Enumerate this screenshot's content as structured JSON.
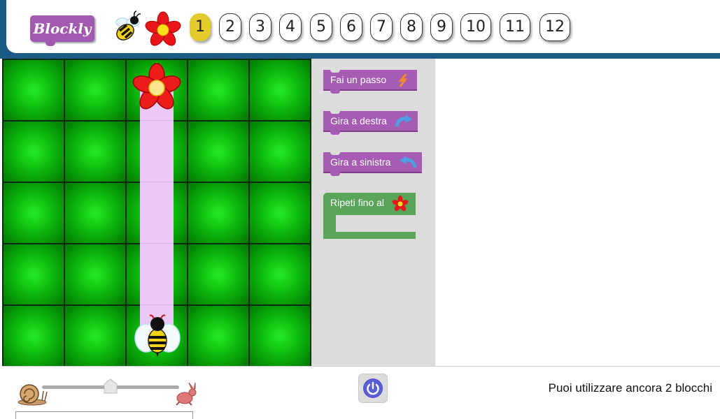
{
  "app": {
    "logo_text": "Blockly"
  },
  "header": {
    "icons": [
      "bee-icon",
      "flower-icon"
    ],
    "levels": [
      "1",
      "2",
      "3",
      "4",
      "5",
      "6",
      "7",
      "8",
      "9",
      "10",
      "11",
      "12"
    ],
    "active_level": "1",
    "colors": {
      "frame": "#1b5a85",
      "active_level": "#e2cc2c"
    }
  },
  "maze": {
    "rows": 5,
    "cols": 5,
    "goal_icon": "flower-icon",
    "player_icon": "bee-icon"
  },
  "toolbox": {
    "blocks": [
      {
        "label": "Fai un passo",
        "icon": "move-forward-icon",
        "color": "#a55cb2"
      },
      {
        "label": "Gira a destra",
        "icon": "turn-right-icon",
        "color": "#a55cb2"
      },
      {
        "label": "Gira a sinistra",
        "icon": "turn-left-icon",
        "color": "#a55cb2"
      },
      {
        "label": "Ripeti fino al",
        "icon": "flower-icon",
        "color": "#5ba55b"
      }
    ]
  },
  "controls": {
    "speed_slow_icon": "snail-icon",
    "speed_fast_icon": "rabbit-icon",
    "run_icon": "power-icon",
    "blocks_remaining_text": "Puoi utilizzare ancora 2 blocchi"
  }
}
